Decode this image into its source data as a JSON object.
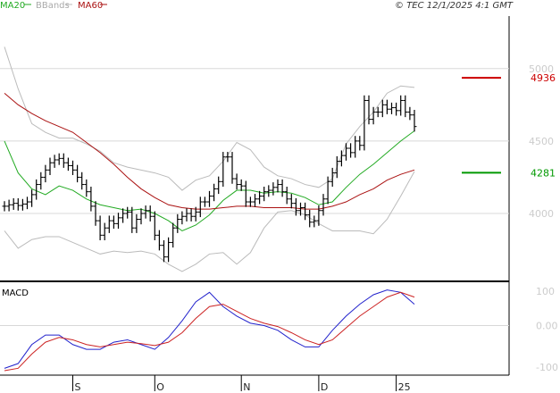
{
  "chart_data": [
    {
      "type": "line",
      "panel": "price",
      "legend": [
        {
          "name": "MA20",
          "color": "#22aa22"
        },
        {
          "name": "BBands",
          "color": "#bbbbbb"
        },
        {
          "name": "MA60",
          "color": "#aa1111"
        }
      ],
      "copyright": "© TEC 12/1/2025 4:1 GMT",
      "ylim": [
        3550,
        5350
      ],
      "yticks": [
        4000,
        4500,
        5000
      ],
      "ytick_labels": [
        "4000",
        "4500",
        "5000"
      ],
      "xlim": [
        0,
        100
      ],
      "xticks": [
        {
          "x": 15,
          "label": "S"
        },
        {
          "x": 33,
          "label": "O"
        },
        {
          "x": 52,
          "label": "N"
        },
        {
          "x": 69,
          "label": "D"
        },
        {
          "x": 86,
          "label": "25"
        }
      ],
      "levels": [
        {
          "value": 4936,
          "label": "4936",
          "color": "#cc0000"
        },
        {
          "value": 4281,
          "label": "4281",
          "color": "#009900"
        }
      ],
      "series": [
        {
          "name": "Price",
          "color": "#000000",
          "x": [
            0,
            1,
            2,
            3,
            4,
            5,
            6,
            7,
            8,
            9,
            10,
            11,
            12,
            13,
            14,
            15,
            16,
            17,
            18,
            19,
            20,
            21,
            22,
            23,
            24,
            25,
            26,
            27,
            28,
            29,
            30,
            31,
            32,
            33,
            34,
            35,
            36,
            37,
            38,
            39,
            40,
            41,
            42,
            43,
            44,
            45,
            46,
            47,
            48,
            49,
            50,
            51,
            52,
            53,
            54,
            55,
            56,
            57,
            58,
            59,
            60,
            61,
            62,
            63,
            64,
            65,
            66,
            67,
            68,
            69,
            70,
            71,
            72,
            73,
            74,
            75,
            76,
            77,
            78,
            79,
            80,
            81,
            82,
            83,
            84,
            85,
            86,
            87,
            88,
            89,
            90
          ],
          "values": [
            4050,
            4060,
            4070,
            4055,
            4065,
            4080,
            4130,
            4200,
            4250,
            4300,
            4350,
            4370,
            4380,
            4350,
            4330,
            4300,
            4250,
            4200,
            4150,
            4050,
            3950,
            3850,
            3900,
            3950,
            3930,
            3970,
            4000,
            4010,
            3900,
            3960,
            4000,
            4020,
            3980,
            3850,
            3780,
            3700,
            3800,
            3900,
            3960,
            3980,
            4000,
            3980,
            4010,
            4080,
            4080,
            4120,
            4170,
            4220,
            4390,
            4390,
            4240,
            4200,
            4190,
            4080,
            4080,
            4100,
            4120,
            4150,
            4160,
            4180,
            4200,
            4150,
            4100,
            4070,
            4020,
            4040,
            3990,
            3940,
            3950,
            4020,
            4100,
            4220,
            4280,
            4360,
            4400,
            4450,
            4420,
            4500,
            4470,
            4780,
            4650,
            4700,
            4700,
            4750,
            4720,
            4730,
            4710,
            4780,
            4700,
            4680,
            4600
          ]
        },
        {
          "name": "MA20",
          "color": "#22aa22",
          "x": [
            0,
            3,
            6,
            9,
            12,
            15,
            18,
            21,
            24,
            27,
            30,
            33,
            36,
            39,
            42,
            45,
            48,
            51,
            54,
            57,
            60,
            63,
            66,
            69,
            72,
            75,
            78,
            81,
            84,
            87,
            90
          ],
          "values": [
            4500,
            4280,
            4170,
            4130,
            4190,
            4160,
            4100,
            4060,
            4040,
            4020,
            4030,
            4000,
            3950,
            3880,
            3920,
            3990,
            4090,
            4160,
            4160,
            4140,
            4150,
            4140,
            4110,
            4060,
            4080,
            4180,
            4270,
            4340,
            4420,
            4500,
            4570
          ]
        },
        {
          "name": "BB upper",
          "color": "#bbbbbb",
          "x": [
            0,
            3,
            6,
            9,
            12,
            15,
            18,
            21,
            24,
            27,
            30,
            33,
            36,
            39,
            42,
            45,
            48,
            51,
            54,
            57,
            60,
            63,
            66,
            69,
            72,
            75,
            78,
            81,
            84,
            87,
            90
          ],
          "values": [
            5150,
            4860,
            4620,
            4560,
            4520,
            4520,
            4480,
            4430,
            4350,
            4320,
            4300,
            4280,
            4250,
            4160,
            4230,
            4260,
            4360,
            4490,
            4440,
            4320,
            4260,
            4240,
            4200,
            4180,
            4240,
            4480,
            4600,
            4700,
            4830,
            4880,
            4870
          ]
        },
        {
          "name": "BB lower",
          "color": "#bbbbbb",
          "x": [
            0,
            3,
            6,
            9,
            12,
            15,
            18,
            21,
            24,
            27,
            30,
            33,
            36,
            39,
            42,
            45,
            48,
            51,
            54,
            57,
            60,
            63,
            66,
            69,
            72,
            75,
            78,
            81,
            84,
            87,
            90
          ],
          "values": [
            3880,
            3760,
            3820,
            3840,
            3840,
            3800,
            3760,
            3720,
            3740,
            3730,
            3740,
            3720,
            3650,
            3600,
            3650,
            3720,
            3730,
            3650,
            3730,
            3900,
            4010,
            4020,
            3990,
            3930,
            3880,
            3880,
            3880,
            3860,
            3960,
            4120,
            4290
          ]
        },
        {
          "name": "MA60",
          "color": "#aa1111",
          "x": [
            0,
            3,
            6,
            9,
            12,
            15,
            18,
            21,
            24,
            27,
            30,
            33,
            36,
            39,
            42,
            45,
            48,
            51,
            54,
            57,
            60,
            63,
            66,
            69,
            72,
            75,
            78,
            81,
            84,
            87,
            90
          ],
          "values": [
            4830,
            4750,
            4690,
            4640,
            4600,
            4560,
            4490,
            4420,
            4340,
            4250,
            4170,
            4110,
            4060,
            4040,
            4030,
            4030,
            4040,
            4050,
            4050,
            4040,
            4040,
            4040,
            4030,
            4030,
            4050,
            4080,
            4130,
            4170,
            4230,
            4270,
            4300
          ]
        }
      ]
    },
    {
      "type": "line",
      "panel": "macd",
      "title": "MACD",
      "ylim": [
        -95,
        80
      ],
      "yticks": [
        100,
        0,
        -100
      ],
      "ytick_labels": [
        "100",
        "0.00",
        "-100"
      ],
      "series": [
        {
          "name": "MACD",
          "color": "#2222cc",
          "x": [
            0,
            3,
            6,
            9,
            12,
            15,
            18,
            21,
            24,
            27,
            30,
            33,
            36,
            39,
            42,
            45,
            48,
            51,
            54,
            57,
            60,
            63,
            66,
            69,
            72,
            75,
            78,
            81,
            84,
            87,
            90
          ],
          "values": [
            -90,
            -80,
            -40,
            -20,
            -20,
            -40,
            -50,
            -50,
            -35,
            -30,
            -40,
            -50,
            -25,
            10,
            50,
            70,
            40,
            20,
            5,
            0,
            -10,
            -30,
            -45,
            -45,
            -10,
            20,
            45,
            65,
            75,
            70,
            45
          ]
        },
        {
          "name": "Signal",
          "color": "#cc2222",
          "x": [
            0,
            3,
            6,
            9,
            12,
            15,
            18,
            21,
            24,
            27,
            30,
            33,
            36,
            39,
            42,
            45,
            48,
            51,
            54,
            57,
            60,
            63,
            66,
            69,
            72,
            75,
            78,
            81,
            84,
            87,
            90
          ],
          "values": [
            -95,
            -90,
            -60,
            -35,
            -25,
            -30,
            -40,
            -45,
            -40,
            -35,
            -38,
            -42,
            -35,
            -15,
            15,
            40,
            45,
            30,
            15,
            5,
            -2,
            -15,
            -30,
            -40,
            -30,
            -5,
            20,
            40,
            60,
            70,
            60
          ]
        }
      ]
    }
  ],
  "labels": {
    "ma20": "MA20",
    "bbands": "BBands",
    "ma60": "MA60",
    "copyright": "© TEC 12/1/2025 4:1 GMT",
    "macd": "MACD"
  }
}
